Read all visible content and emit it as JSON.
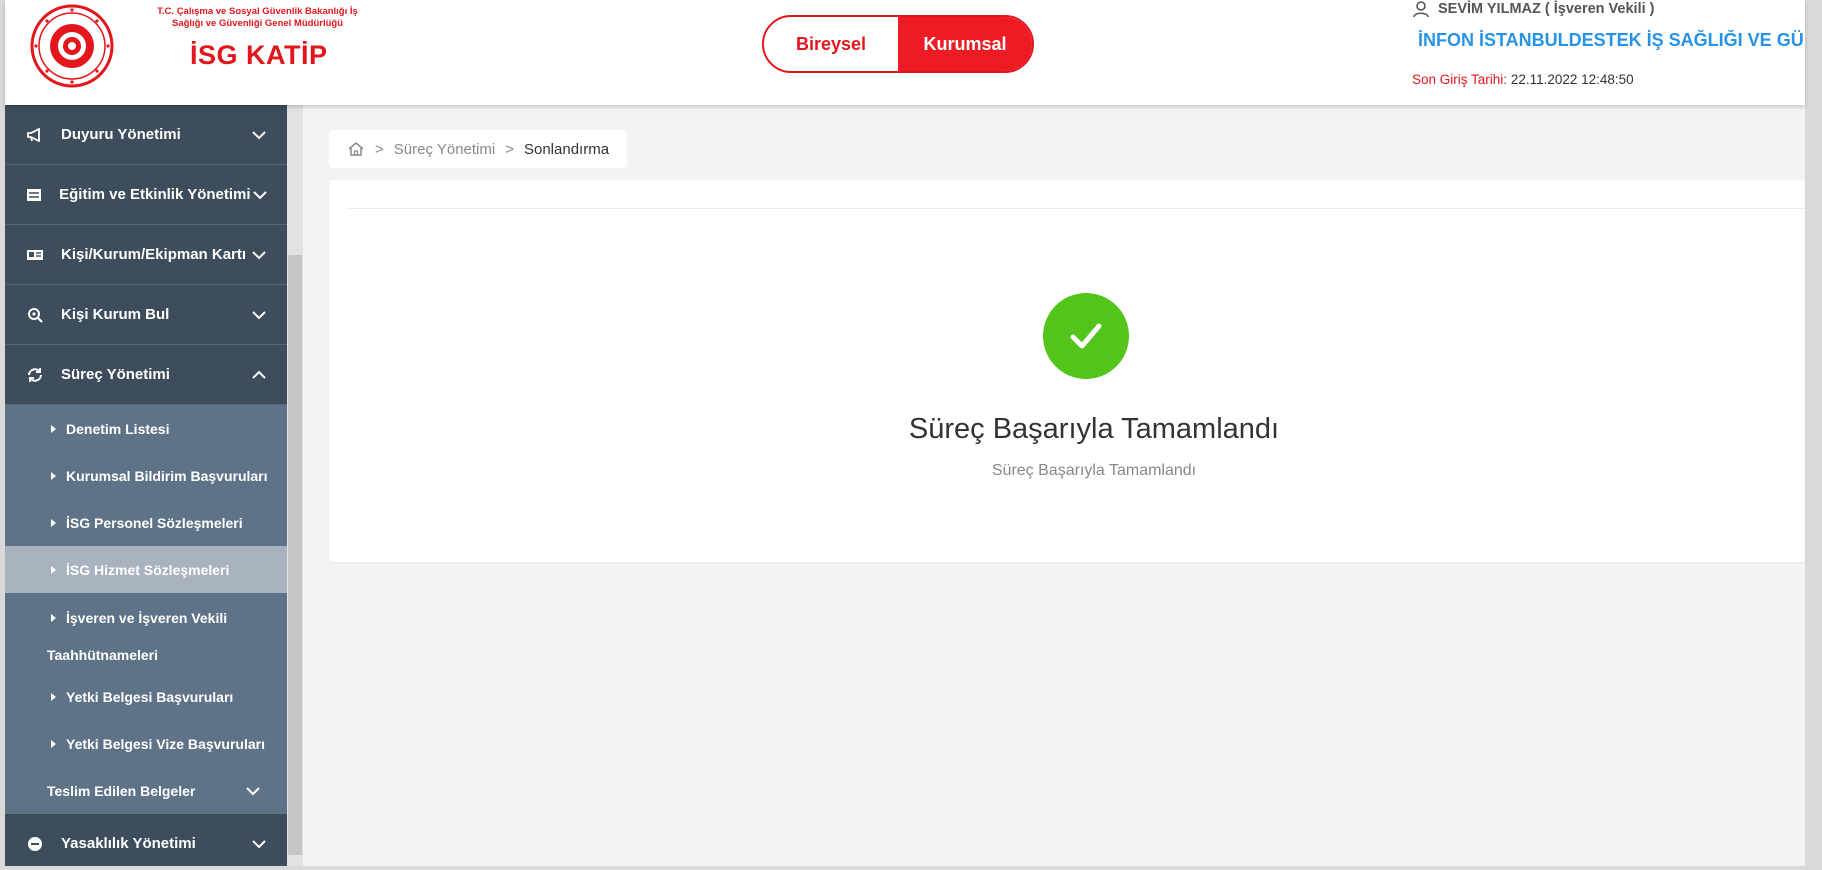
{
  "header": {
    "ministry": "T.C. Çalışma ve Sosyal Güvenlik Bakanlığı İş Sağlığı ve Güvenliği Genel Müdürlüğü",
    "brand": "İSG KATİP",
    "switch": {
      "option_a": "Bireysel",
      "option_b": "Kurumsal",
      "selected": "Kurumsal"
    },
    "user": "SEVİM YILMAZ ( İşveren Vekili )",
    "organization": "İNFON İSTANBULDESTEK İŞ SAĞLIĞI VE GÜ...",
    "last_login_label": "Son Giriş Tarihi:",
    "last_login_value": "22.11.2022 12:48:50"
  },
  "sidebar": {
    "items": [
      {
        "label": "Duyuru Yönetimi",
        "icon": "megaphone-icon"
      },
      {
        "label": "Eğitim ve Etkinlik Yönetimi",
        "icon": "list-icon"
      },
      {
        "label": "Kişi/Kurum/Ekipman Kartı",
        "icon": "id-card-icon"
      },
      {
        "label": "Kişi Kurum Bul",
        "icon": "search-icon"
      },
      {
        "label": "Süreç Yönetimi",
        "icon": "refresh-icon",
        "expanded": true
      },
      {
        "label": "Yasaklılık Yönetimi",
        "icon": "minus-circle-icon"
      }
    ],
    "sub_items": [
      {
        "label": "Denetim Listesi"
      },
      {
        "label": "Kurumsal Bildirim Başvuruları"
      },
      {
        "label": "İSG Personel Sözleşmeleri"
      },
      {
        "label": "İSG Hizmet Sözleşmeleri",
        "active": true
      },
      {
        "label_line1": "İşveren ve İşveren Vekili",
        "label_line2": "Taahhütnameleri"
      },
      {
        "label": "Yetki Belgesi Başvuruları"
      },
      {
        "label": "Yetki Belgesi Vize Başvuruları"
      },
      {
        "label": "Teslim Edilen Belgeler"
      }
    ]
  },
  "breadcrumb": {
    "sep": ">",
    "section": "Süreç Yönetimi",
    "current": "Sonlandırma"
  },
  "result": {
    "title": "Süreç Başarıyla Tamamlandı",
    "subtitle": "Süreç Başarıyla Tamamlandı",
    "status_color": "#52c41a"
  },
  "colors": {
    "brand_red": "#e3161d",
    "sidebar_bg": "#3d4d5c",
    "link_blue": "#2693e6"
  }
}
